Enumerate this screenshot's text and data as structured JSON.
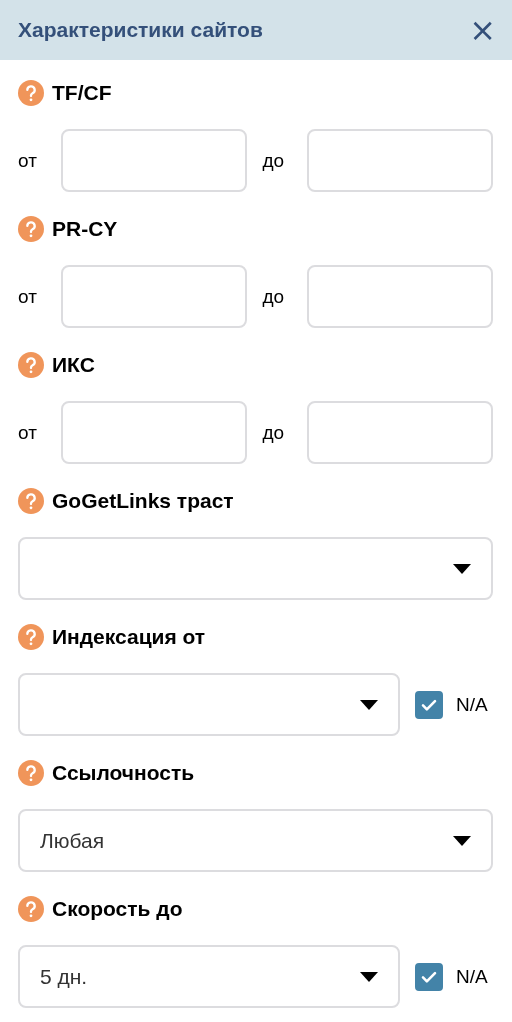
{
  "panel": {
    "title": "Характеристики сайтов",
    "close": "×"
  },
  "filters": [
    {
      "kind": "range",
      "label": "TF/CF",
      "from_label": "от",
      "to_label": "до"
    },
    {
      "kind": "range",
      "label": "PR-CY",
      "from_label": "от",
      "to_label": "до"
    },
    {
      "kind": "range",
      "label": "ИКС",
      "from_label": "от",
      "to_label": "до"
    },
    {
      "kind": "select",
      "label": "GoGetLinks траст"
    },
    {
      "kind": "select",
      "label": "Индексация от",
      "na": {
        "label": "N/A",
        "checked": true
      }
    },
    {
      "kind": "select",
      "label": "Ссылочность",
      "value": "Любая"
    },
    {
      "kind": "select",
      "label": "Скорость до",
      "value": "5 дн.",
      "na": {
        "label": "N/A",
        "checked": true
      }
    }
  ]
}
